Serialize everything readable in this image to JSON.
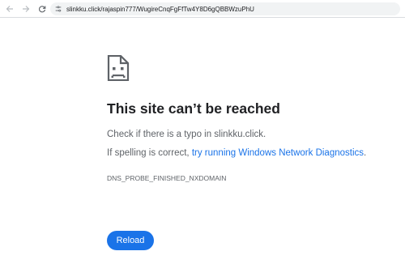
{
  "browser": {
    "address_bar": {
      "url": "slinkku.click/rajaspin777/WugireCnqFgFfTw4Y8D6gQBBWzuPhU"
    }
  },
  "error_page": {
    "title": "This site can’t be reached",
    "typo_hint": "Check if there is a typo in slinkku.click.",
    "spelling_prefix": "If spelling is correct, ",
    "diagnostics_link": "try running Windows Network Diagnostics",
    "spelling_suffix": ".",
    "error_code": "DNS_PROBE_FINISHED_NXDOMAIN",
    "reload_label": "Reload"
  },
  "icons": {
    "back": "back-arrow-icon",
    "forward": "forward-arrow-icon",
    "reload": "reload-icon",
    "site_info": "site-info-icon",
    "sad_page": "sad-page-icon"
  },
  "colors": {
    "accent": "#1a73e8",
    "title": "#202124",
    "body_text": "#5f6368"
  }
}
